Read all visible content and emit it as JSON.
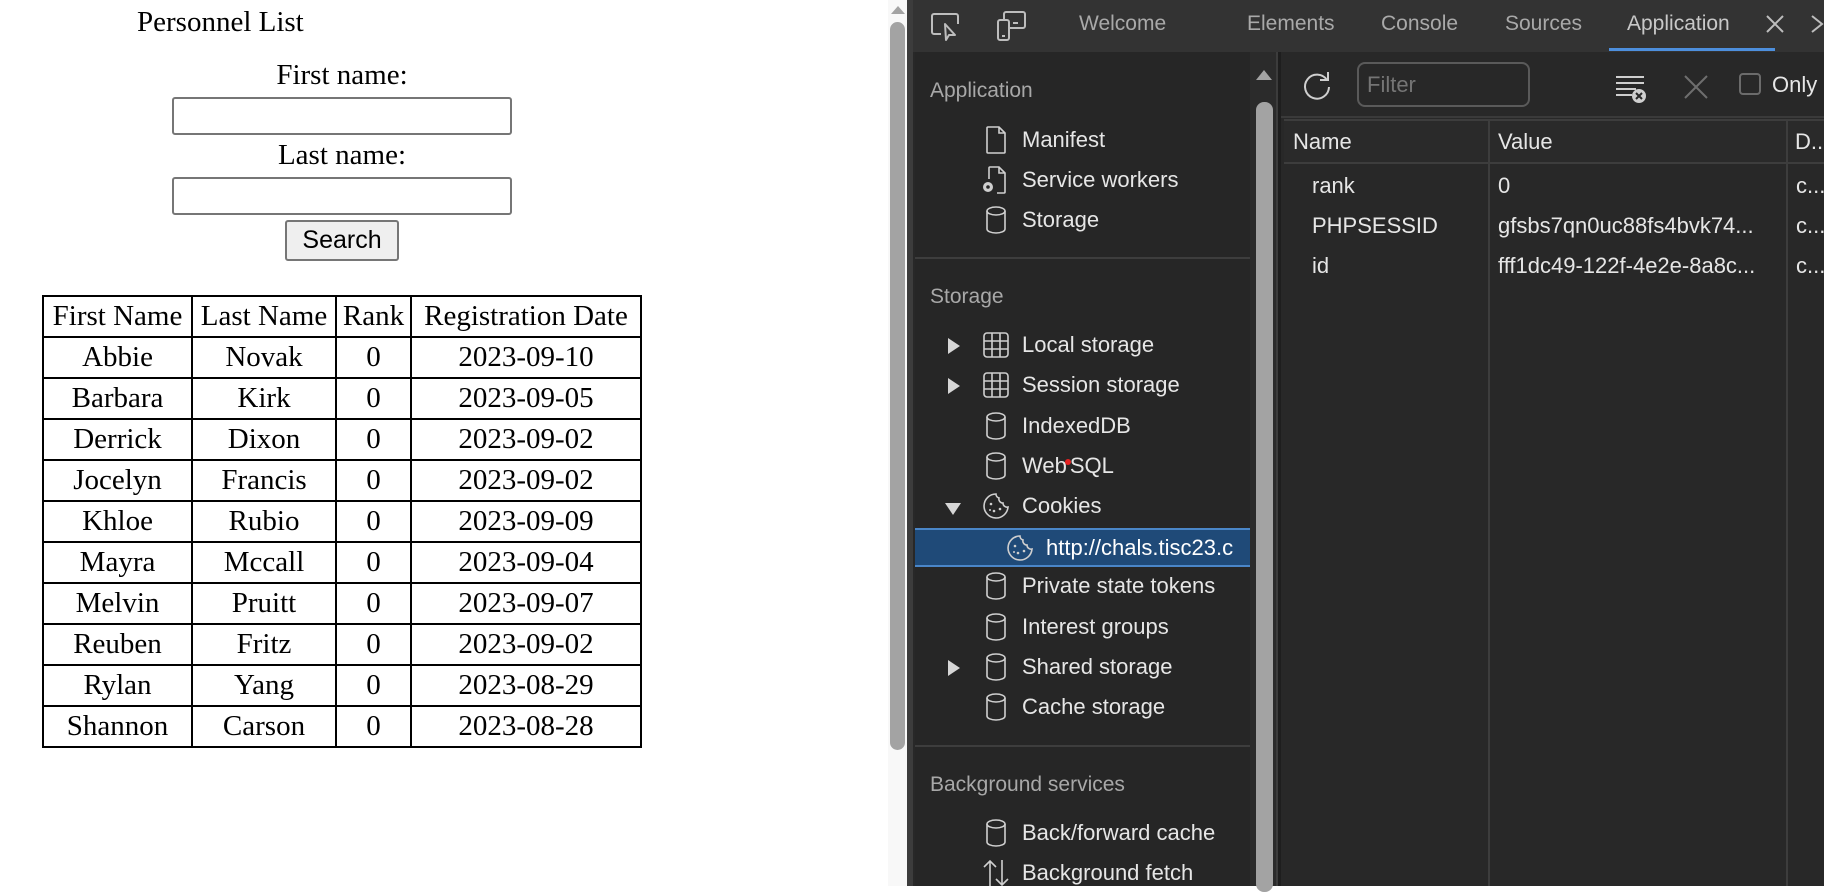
{
  "page": {
    "title": "Personnel List",
    "form": {
      "first_name_label": "First name:",
      "first_name_value": "",
      "last_name_label": "Last name:",
      "last_name_value": "",
      "search_label": "Search"
    },
    "table": {
      "headers": [
        "First Name",
        "Last Name",
        "Rank",
        "Registration Date"
      ],
      "rows": [
        [
          "Abbie",
          "Novak",
          "0",
          "2023-09-10"
        ],
        [
          "Barbara",
          "Kirk",
          "0",
          "2023-09-05"
        ],
        [
          "Derrick",
          "Dixon",
          "0",
          "2023-09-02"
        ],
        [
          "Jocelyn",
          "Francis",
          "0",
          "2023-09-02"
        ],
        [
          "Khloe",
          "Rubio",
          "0",
          "2023-09-09"
        ],
        [
          "Mayra",
          "Mccall",
          "0",
          "2023-09-04"
        ],
        [
          "Melvin",
          "Pruitt",
          "0",
          "2023-09-07"
        ],
        [
          "Reuben",
          "Fritz",
          "0",
          "2023-09-02"
        ],
        [
          "Rylan",
          "Yang",
          "0",
          "2023-08-29"
        ],
        [
          "Shannon",
          "Carson",
          "0",
          "2023-08-28"
        ]
      ]
    }
  },
  "devtools": {
    "toolbar_icons": [
      "inspect-element-icon",
      "device-toolbar-icon"
    ],
    "tabs": [
      {
        "label": "Welcome",
        "active": false
      },
      {
        "label": "Elements",
        "active": false
      },
      {
        "label": "Console",
        "active": false
      },
      {
        "label": "Sources",
        "active": false
      },
      {
        "label": "Application",
        "active": true
      }
    ],
    "close_tab_label": "✕",
    "sidebar": {
      "sections": [
        {
          "heading": "Application",
          "items": [
            {
              "label": "Manifest",
              "icon": "file-icon"
            },
            {
              "label": "Service workers",
              "icon": "service-worker-icon"
            },
            {
              "label": "Storage",
              "icon": "database-icon"
            }
          ]
        },
        {
          "heading": "Storage",
          "items": [
            {
              "label": "Local storage",
              "icon": "grid-icon",
              "expander": "collapsed"
            },
            {
              "label": "Session storage",
              "icon": "grid-icon",
              "expander": "collapsed"
            },
            {
              "label": "IndexedDB",
              "icon": "database-icon"
            },
            {
              "label_a": "Web",
              "label_b": "SQL",
              "icon": "database-icon"
            },
            {
              "label": "Cookies",
              "icon": "cookie-icon",
              "expander": "expanded"
            },
            {
              "label": "http://chals.tisc23.c",
              "icon": "cookie-icon",
              "selected": true,
              "child": true
            },
            {
              "label": "Private state tokens",
              "icon": "database-icon"
            },
            {
              "label": "Interest groups",
              "icon": "database-icon"
            },
            {
              "label": "Shared storage",
              "icon": "database-icon",
              "expander": "collapsed"
            },
            {
              "label": "Cache storage",
              "icon": "database-icon"
            }
          ]
        },
        {
          "heading": "Background services",
          "items": [
            {
              "label": "Back/forward cache",
              "icon": "database-icon"
            },
            {
              "label": "Background fetch",
              "icon": "up-down-arrows-icon"
            }
          ]
        }
      ]
    },
    "cookies": {
      "filter_placeholder": "Filter",
      "only_label": "Only",
      "columns": [
        "Name",
        "Value",
        "D..."
      ],
      "rows": [
        {
          "name": "rank",
          "value": "0",
          "domain": "c..."
        },
        {
          "name": "PHPSESSID",
          "value": "gfsbs7qn0uc88fs4bvk74...",
          "domain": "c..."
        },
        {
          "name": "id",
          "value": "fff1dc49-122f-4e2e-8a8c...",
          "domain": "c..."
        }
      ]
    }
  }
}
